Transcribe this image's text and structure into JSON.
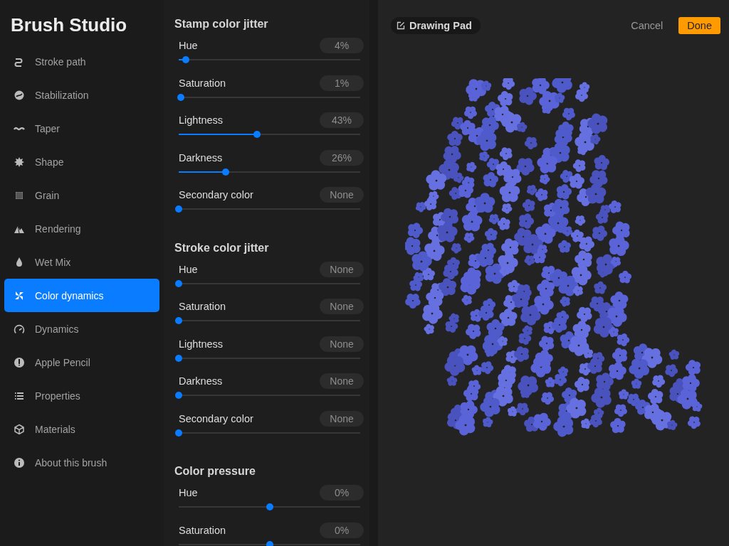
{
  "sidebar": {
    "title": "Brush Studio",
    "items": [
      {
        "label": "Stroke path",
        "selected": false
      },
      {
        "label": "Stabilization",
        "selected": false
      },
      {
        "label": "Taper",
        "selected": false
      },
      {
        "label": "Shape",
        "selected": false
      },
      {
        "label": "Grain",
        "selected": false
      },
      {
        "label": "Rendering",
        "selected": false
      },
      {
        "label": "Wet Mix",
        "selected": false
      },
      {
        "label": "Color dynamics",
        "selected": true
      },
      {
        "label": "Dynamics",
        "selected": false
      },
      {
        "label": "Apple Pencil",
        "selected": false
      },
      {
        "label": "Properties",
        "selected": false
      },
      {
        "label": "Materials",
        "selected": false
      },
      {
        "label": "About this brush",
        "selected": false
      }
    ]
  },
  "settings": {
    "sections": [
      {
        "title": "Stamp color jitter",
        "sliders": [
          {
            "label": "Hue",
            "value": "4%",
            "kind": "fill",
            "level": 0.04
          },
          {
            "label": "Saturation",
            "value": "1%",
            "kind": "fill",
            "level": 0.01
          },
          {
            "label": "Lightness",
            "value": "43%",
            "kind": "fill",
            "level": 0.43
          },
          {
            "label": "Darkness",
            "value": "26%",
            "kind": "fill",
            "level": 0.26
          },
          {
            "label": "Secondary color",
            "value": "None",
            "kind": "fill",
            "level": 0
          }
        ]
      },
      {
        "title": "Stroke color jitter",
        "sliders": [
          {
            "label": "Hue",
            "value": "None",
            "kind": "fill",
            "level": 0
          },
          {
            "label": "Saturation",
            "value": "None",
            "kind": "fill",
            "level": 0
          },
          {
            "label": "Lightness",
            "value": "None",
            "kind": "fill",
            "level": 0
          },
          {
            "label": "Darkness",
            "value": "None",
            "kind": "fill",
            "level": 0
          },
          {
            "label": "Secondary color",
            "value": "None",
            "kind": "fill",
            "level": 0
          }
        ]
      },
      {
        "title": "Color pressure",
        "sliders": [
          {
            "label": "Hue",
            "value": "0%",
            "kind": "centered",
            "level": 0.5
          },
          {
            "label": "Saturation",
            "value": "0%",
            "kind": "centered",
            "level": 0.5
          }
        ]
      }
    ]
  },
  "drawing_pad": {
    "title": "Drawing Pad",
    "cancel": "Cancel",
    "done": "Done"
  }
}
